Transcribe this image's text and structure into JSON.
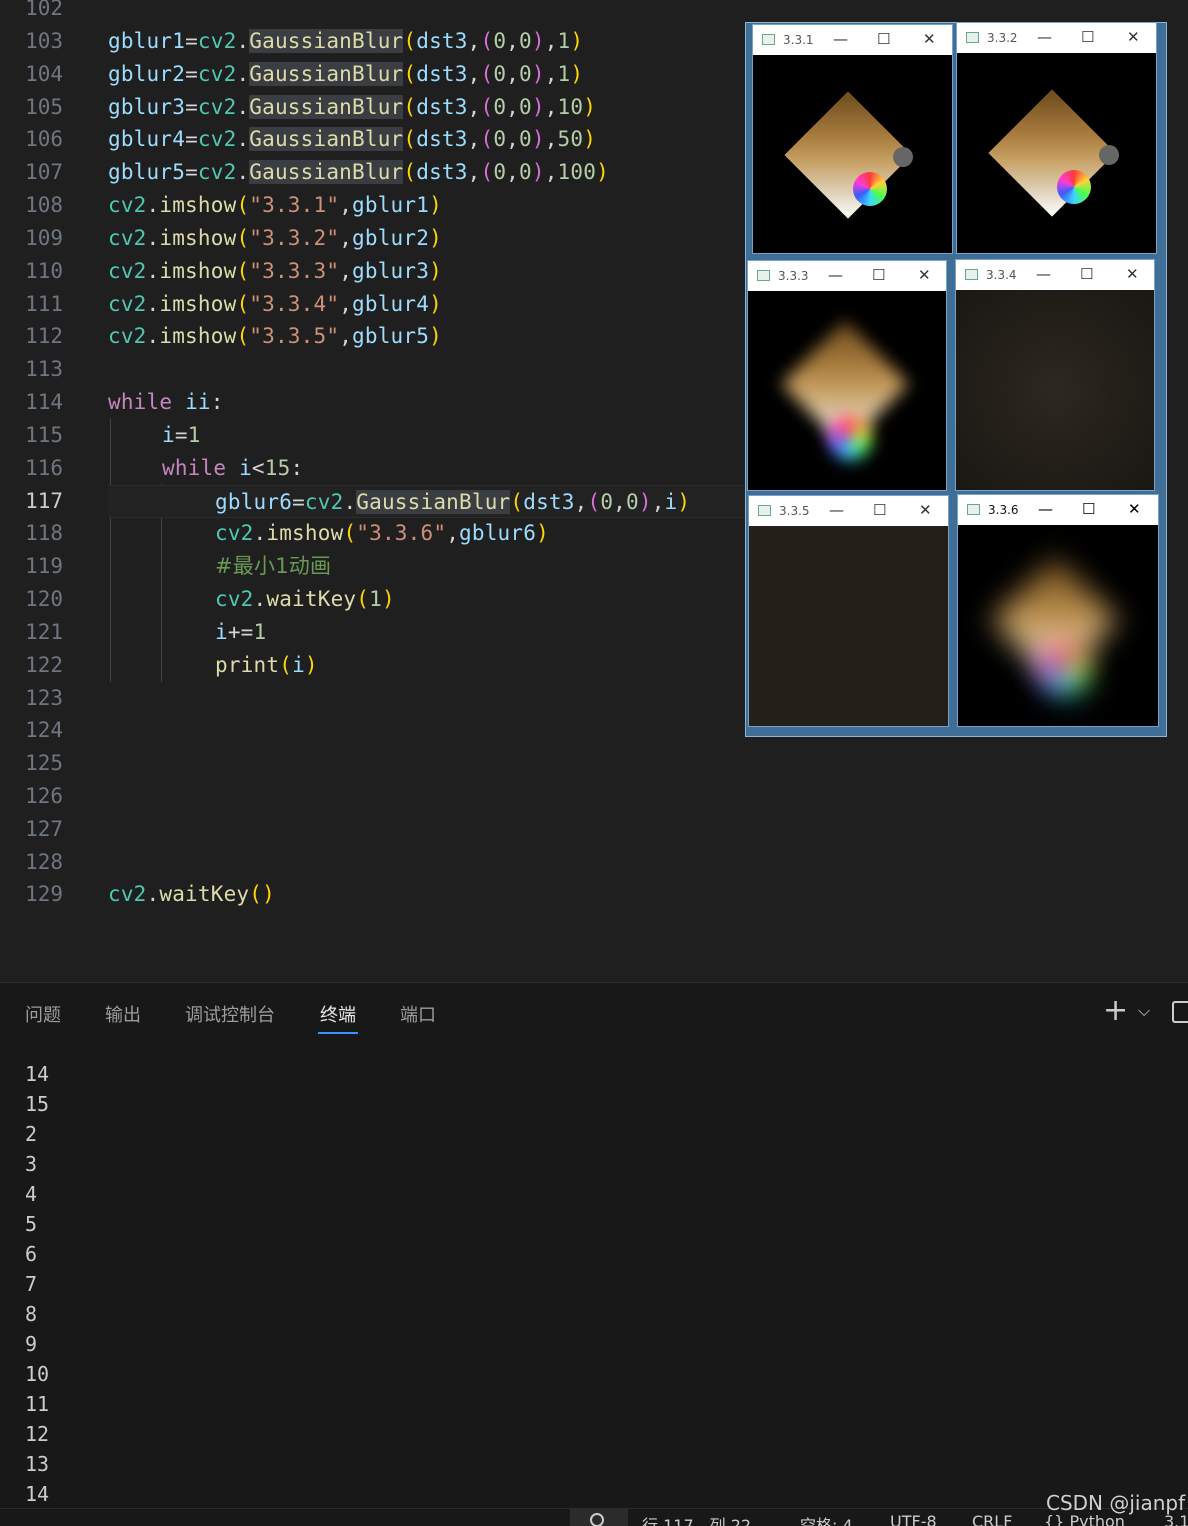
{
  "editor": {
    "lines": [
      {
        "num": "102"
      },
      {
        "num": "103"
      },
      {
        "num": "104"
      },
      {
        "num": "105"
      },
      {
        "num": "106"
      },
      {
        "num": "107"
      },
      {
        "num": "108"
      },
      {
        "num": "109"
      },
      {
        "num": "110"
      },
      {
        "num": "111"
      },
      {
        "num": "112"
      },
      {
        "num": "113"
      },
      {
        "num": "114"
      },
      {
        "num": "115"
      },
      {
        "num": "116"
      },
      {
        "num": "117"
      },
      {
        "num": "118"
      },
      {
        "num": "119"
      },
      {
        "num": "120"
      },
      {
        "num": "121"
      },
      {
        "num": "122"
      },
      {
        "num": "123"
      },
      {
        "num": "124"
      },
      {
        "num": "125"
      },
      {
        "num": "126"
      },
      {
        "num": "127"
      },
      {
        "num": "128"
      },
      {
        "num": "129"
      }
    ],
    "active_line": "117"
  },
  "windows": [
    {
      "title": "3.3.1",
      "min": "—",
      "max": "☐",
      "close": "✕"
    },
    {
      "title": "3.3.2",
      "min": "—",
      "max": "☐",
      "close": "✕"
    },
    {
      "title": "3.3.3",
      "min": "—",
      "max": "☐",
      "close": "✕"
    },
    {
      "title": "3.3.4",
      "min": "—",
      "max": "☐",
      "close": "✕"
    },
    {
      "title": "3.3.5",
      "min": "—",
      "max": "☐",
      "close": "✕"
    },
    {
      "title": "3.3.6",
      "min": "—",
      "max": "☐",
      "close": "✕"
    }
  ],
  "panel": {
    "tabs": [
      "问题",
      "输出",
      "调试控制台",
      "终端",
      "端口"
    ],
    "active_tab": "终端",
    "add_icon": "+",
    "dropdown_icon": "⌵",
    "terminal_lines": [
      "14",
      "15",
      "2",
      "3",
      "4",
      "5",
      "6",
      "7",
      "8",
      "9",
      "10",
      "11",
      "12",
      "13",
      "14"
    ]
  },
  "status": {
    "items": [
      "行 117，列 22",
      "空格: 4",
      "UTF-8",
      "CRLF",
      "{} Python",
      "3.1"
    ]
  },
  "watermark": "CSDN @jianpf",
  "colors": {
    "keyword": "#c586c0",
    "variable": "#9cdcfe",
    "function": "#dcdcaa",
    "string": "#ce9178",
    "number": "#b5cea8",
    "comment": "#6a9955",
    "active_tab_underline": "#3794ff"
  }
}
